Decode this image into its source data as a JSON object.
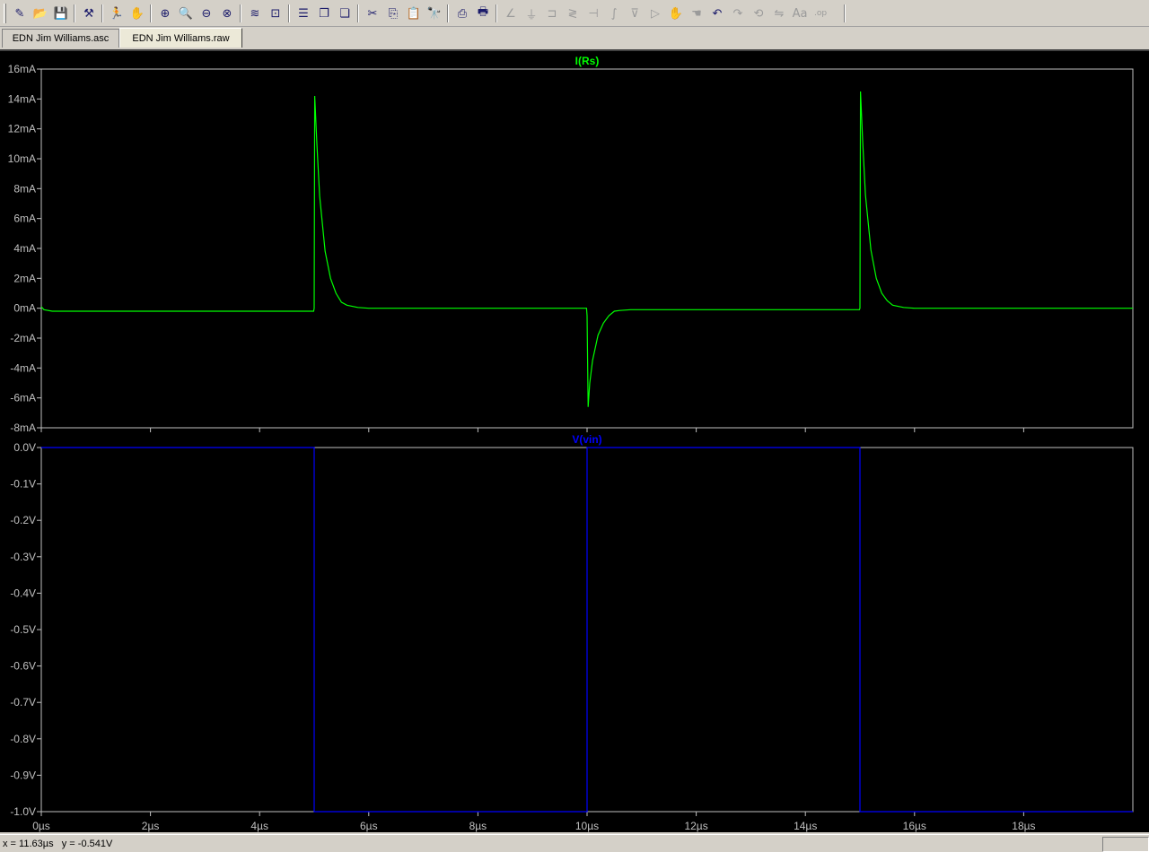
{
  "toolbar": {
    "buttons": [
      {
        "icon": "new-schematic-icon",
        "glyph": "✎",
        "enabled": true
      },
      {
        "icon": "open-icon",
        "glyph": "📂",
        "enabled": true
      },
      {
        "icon": "save-icon",
        "glyph": "💾",
        "enabled": true
      },
      {
        "icon": "control-panel-icon",
        "glyph": "⚒",
        "enabled": true
      },
      {
        "icon": "run-icon",
        "glyph": "🏃",
        "enabled": true
      },
      {
        "icon": "halt-icon",
        "glyph": "✋",
        "enabled": false
      },
      {
        "icon": "zoom-in-icon",
        "glyph": "⊕",
        "enabled": true
      },
      {
        "icon": "zoom-pan-icon",
        "glyph": "🔍",
        "enabled": true
      },
      {
        "icon": "zoom-out-icon",
        "glyph": "⊖",
        "enabled": true
      },
      {
        "icon": "zoom-cancel-icon",
        "glyph": "⊗",
        "enabled": true
      },
      {
        "icon": "autorange-icon",
        "glyph": "≋",
        "enabled": true
      },
      {
        "icon": "fit-icon",
        "glyph": "⊡",
        "enabled": true
      },
      {
        "icon": "tile-horizontal-icon",
        "glyph": "☰",
        "enabled": true
      },
      {
        "icon": "cascade-icon",
        "glyph": "❐",
        "enabled": true
      },
      {
        "icon": "tile-vertical-icon",
        "glyph": "❏",
        "enabled": true
      },
      {
        "icon": "cut-icon",
        "glyph": "✂",
        "enabled": true
      },
      {
        "icon": "copy-icon",
        "glyph": "⎘",
        "enabled": true
      },
      {
        "icon": "paste-icon",
        "glyph": "📋",
        "enabled": true
      },
      {
        "icon": "find-icon",
        "glyph": "🔭",
        "enabled": true
      },
      {
        "icon": "print-preview-icon",
        "glyph": "⎙",
        "enabled": true
      },
      {
        "icon": "print-icon",
        "glyph": "🖶",
        "enabled": true
      },
      {
        "icon": "wire-icon",
        "glyph": "∠",
        "enabled": false
      },
      {
        "icon": "ground-icon",
        "glyph": "⏚",
        "enabled": false
      },
      {
        "icon": "label-net-icon",
        "glyph": "⊐",
        "enabled": false
      },
      {
        "icon": "resistor-icon",
        "glyph": "≷",
        "enabled": false
      },
      {
        "icon": "capacitor-icon",
        "glyph": "⊣",
        "enabled": false
      },
      {
        "icon": "inductor-icon",
        "glyph": "∫",
        "enabled": false
      },
      {
        "icon": "diode-icon",
        "glyph": "⊽",
        "enabled": false
      },
      {
        "icon": "component-icon",
        "glyph": "▷",
        "enabled": false
      },
      {
        "icon": "move-icon",
        "glyph": "✋",
        "enabled": false
      },
      {
        "icon": "drag-icon",
        "glyph": "☚",
        "enabled": false
      },
      {
        "icon": "undo-icon",
        "glyph": "↶",
        "enabled": true
      },
      {
        "icon": "redo-icon",
        "glyph": "↷",
        "enabled": false
      },
      {
        "icon": "rotate-icon",
        "glyph": "⟲",
        "enabled": false
      },
      {
        "icon": "mirror-icon",
        "glyph": "⇋",
        "enabled": false
      },
      {
        "icon": "text-icon",
        "glyph": "Aa",
        "enabled": false
      },
      {
        "icon": "spice-directive-icon",
        "glyph": ".op",
        "enabled": false
      }
    ]
  },
  "tabs": [
    {
      "label": "EDN Jim Williams.asc",
      "active": false
    },
    {
      "label": "EDN Jim Williams.raw",
      "active": true
    }
  ],
  "status": {
    "text": "x = 11.63µs   y = -0.541V"
  },
  "colors": {
    "plot_bg": "#000000",
    "axis": "#c0c0c0",
    "trace_current": "#00ff00",
    "trace_voltage": "#0000ff",
    "tick_label": "#c0c0c0"
  },
  "chart_data": [
    {
      "type": "line",
      "title": "I(Rs)",
      "xlabel": "",
      "ylabel": "",
      "xlim": [
        0,
        20
      ],
      "x_unit": "µs",
      "ylim": [
        -8,
        16
      ],
      "y_unit": "mA",
      "yticks": [
        "16mA",
        "14mA",
        "12mA",
        "10mA",
        "8mA",
        "6mA",
        "4mA",
        "2mA",
        "0mA",
        "-2mA",
        "-4mA",
        "-6mA",
        "-8mA"
      ],
      "ytick_values": [
        16,
        14,
        12,
        10,
        8,
        6,
        4,
        2,
        0,
        -2,
        -4,
        -6,
        -8
      ],
      "series": [
        {
          "name": "I(Rs)",
          "color": "#00ff00",
          "x": [
            0,
            0.05,
            0.2,
            4.99,
            5.0,
            5.01,
            5.05,
            5.1,
            5.2,
            5.3,
            5.4,
            5.5,
            5.6,
            5.8,
            6.0,
            9.99,
            10.0,
            10.02,
            10.05,
            10.1,
            10.2,
            10.3,
            10.4,
            10.5,
            10.6,
            10.8,
            11.0,
            14.99,
            15.0,
            15.01,
            15.05,
            15.1,
            15.2,
            15.3,
            15.4,
            15.5,
            15.6,
            15.8,
            16.0,
            20.0
          ],
          "y": [
            0.1,
            -0.1,
            -0.2,
            -0.2,
            0,
            14.2,
            11.0,
            7.5,
            3.8,
            2.0,
            1.0,
            0.4,
            0.2,
            0.05,
            0,
            0,
            -0.5,
            -6.6,
            -5.0,
            -3.5,
            -1.8,
            -1.0,
            -0.5,
            -0.2,
            -0.15,
            -0.1,
            -0.1,
            -0.1,
            0,
            14.5,
            11.2,
            7.6,
            3.9,
            2.0,
            1.0,
            0.5,
            0.2,
            0.05,
            0,
            0
          ]
        }
      ]
    },
    {
      "type": "line",
      "title": "V(vin)",
      "xlabel": "",
      "ylabel": "",
      "xlim": [
        0,
        20
      ],
      "x_unit": "µs",
      "xticks": [
        "0µs",
        "2µs",
        "4µs",
        "6µs",
        "8µs",
        "10µs",
        "12µs",
        "14µs",
        "16µs",
        "18µs"
      ],
      "xtick_values": [
        0,
        2,
        4,
        6,
        8,
        10,
        12,
        14,
        16,
        18
      ],
      "ylim": [
        -1.0,
        0.0
      ],
      "y_unit": "V",
      "yticks": [
        "0.0V",
        "-0.1V",
        "-0.2V",
        "-0.3V",
        "-0.4V",
        "-0.5V",
        "-0.6V",
        "-0.7V",
        "-0.8V",
        "-0.9V",
        "-1.0V"
      ],
      "ytick_values": [
        0,
        -0.1,
        -0.2,
        -0.3,
        -0.4,
        -0.5,
        -0.6,
        -0.7,
        -0.8,
        -0.9,
        -1.0
      ],
      "series": [
        {
          "name": "V(vin)",
          "color": "#0000ff",
          "x": [
            0,
            5.0,
            5.0,
            10.0,
            10.0,
            15.0,
            15.0,
            20.0
          ],
          "y": [
            0,
            0,
            -1.0,
            -1.0,
            0,
            0,
            -1.0,
            -1.0
          ]
        }
      ]
    }
  ]
}
